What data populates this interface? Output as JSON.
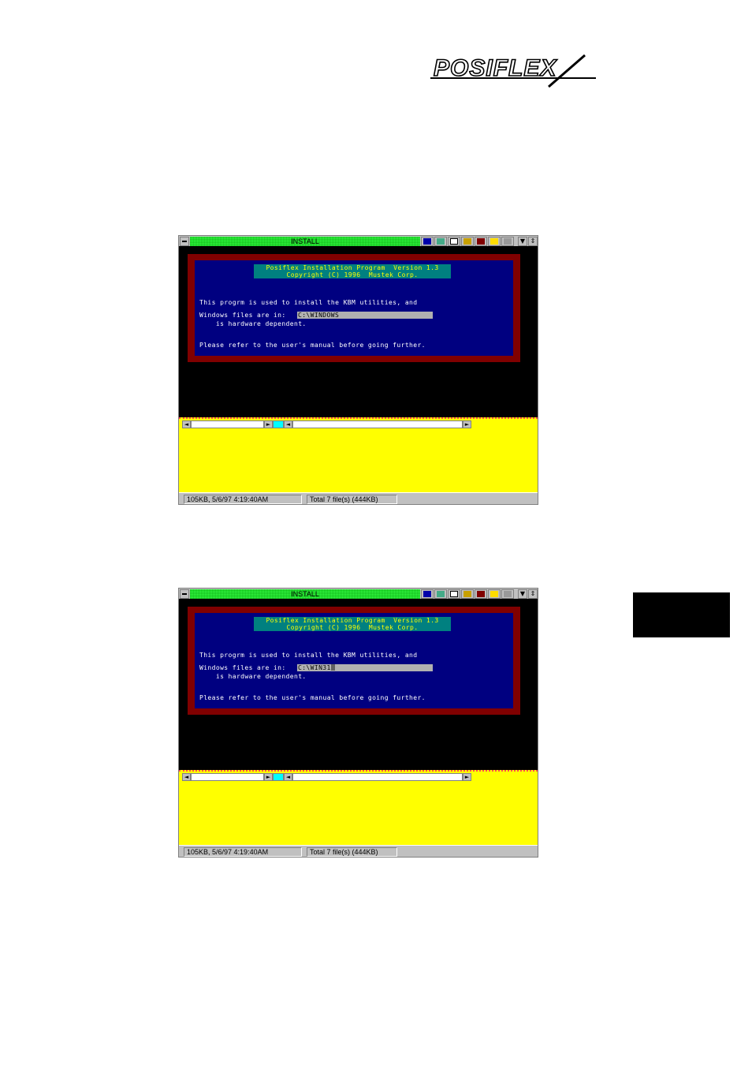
{
  "brand": {
    "logo_text": "POSIFLEX"
  },
  "screens": [
    {
      "window_title": "INSTALL",
      "header_line1": "Posiflex Installation Program  Version 1.3",
      "header_line2": "Copyright (C) 1996  Mustek Corp.",
      "body_line1": "This progrm is used to install the KBM utilities, and",
      "body_line2": "    is hardware dependent.",
      "body_line3": "Please refer to the user's manual before going further.",
      "field_label": "Windows files are in:",
      "field_value": "C:\\WINDOWS",
      "status_left": "105KB, 5/6/97 4:19:40AM",
      "status_right": "Total 7 file(s) (444KB)"
    },
    {
      "window_title": "INSTALL",
      "header_line1": "Posiflex Installation Program  Version 1.3",
      "header_line2": "Copyright (C) 1996  Mustek Corp.",
      "body_line1": "This progrm is used to install the KBM utilities, and",
      "body_line2": "    is hardware dependent.",
      "body_line3": "Please refer to the user's manual before going further.",
      "field_label": "Windows files are in:",
      "field_value": "C:\\WIN31",
      "status_left": "105KB, 5/6/97 4:19:40AM",
      "status_right": "Total 7 file(s) (444KB)"
    }
  ],
  "toolbar_icons": [
    "mode-icon",
    "mark-icon",
    "copy-icon",
    "paste-icon",
    "fullscreen-icon",
    "settings-icon",
    "background-icon"
  ],
  "colors": {
    "title_bar": "#33ff44",
    "dos_frame": "#800000",
    "dos_panel": "#000080",
    "dos_header": "#008080",
    "pane_bg": "#ffff00"
  }
}
